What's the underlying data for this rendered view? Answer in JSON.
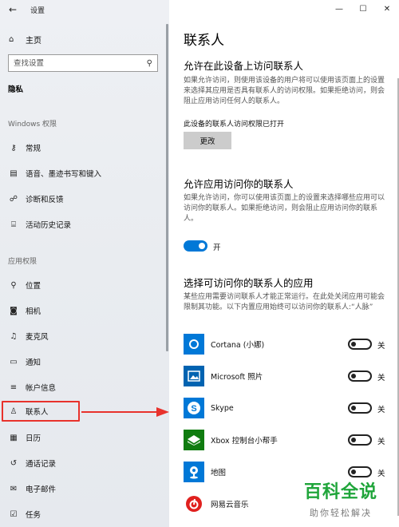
{
  "app": {
    "title": "设置",
    "back_icon": "←"
  },
  "window_controls": {
    "minimize": "—",
    "maximize": "☐",
    "close": "✕"
  },
  "sidebar": {
    "home": {
      "label": "主页",
      "icon": "⌂"
    },
    "search": {
      "placeholder": "查找设置",
      "icon": "⚲"
    },
    "current_section": "隐私",
    "group_windows": "Windows 权限",
    "windows_items": [
      {
        "label": "常规",
        "icon": "lock-icon",
        "glyph": "⚷"
      },
      {
        "label": "语音、墨迹书写和键入",
        "icon": "ink-icon",
        "glyph": "▤"
      },
      {
        "label": "诊断和反馈",
        "icon": "feedback-icon",
        "glyph": "☍"
      },
      {
        "label": "活动历史记录",
        "icon": "history-icon",
        "glyph": "⌸"
      }
    ],
    "group_app": "应用权限",
    "app_items": [
      {
        "label": "位置",
        "icon": "location-icon",
        "glyph": "⚲"
      },
      {
        "label": "相机",
        "icon": "camera-icon",
        "glyph": "◙"
      },
      {
        "label": "麦克风",
        "icon": "microphone-icon",
        "glyph": "♫"
      },
      {
        "label": "通知",
        "icon": "notification-icon",
        "glyph": "▭"
      },
      {
        "label": "帐户信息",
        "icon": "account-info-icon",
        "glyph": "≡"
      },
      {
        "label": "联系人",
        "icon": "contacts-icon",
        "glyph": "♙"
      },
      {
        "label": "日历",
        "icon": "calendar-icon",
        "glyph": "▦"
      },
      {
        "label": "通话记录",
        "icon": "call-history-icon",
        "glyph": "↺"
      },
      {
        "label": "电子邮件",
        "icon": "email-icon",
        "glyph": "✉"
      },
      {
        "label": "任务",
        "icon": "tasks-icon",
        "glyph": "☑"
      }
    ]
  },
  "main": {
    "title": "联系人",
    "section1": {
      "heading": "允许在此设备上访问联系人",
      "description": "如果允许访问，则使用该设备的用户将可以使用该页面上的设置来选择其应用是否具有联系人的访问权限。如果拒绝访问，则会阻止应用访问任何人的联系人。",
      "status": "此设备的联系人访问权限已打开",
      "button": "更改"
    },
    "section2": {
      "heading": "允许应用访问你的联系人",
      "description": "如果允许访问，你可以使用该页面上的设置来选择哪些应用可以访问你的联系人。如果拒绝访问，则会阻止应用访问你的联系人。",
      "toggle_state": "开"
    },
    "section3": {
      "heading": "选择可访问你的联系人的应用",
      "description": "某些应用需要访问联系人才能正常运行。在此处关闭应用可能会限制其功能。以下内置应用始终可以访问你的联系人:“人脉”",
      "apps": [
        {
          "name": "Cortana (小娜)",
          "state": "关",
          "icon": "cortana-icon",
          "color": "#0078d7"
        },
        {
          "name": "Microsoft 照片",
          "state": "关",
          "icon": "photos-icon",
          "color": "#0063b1"
        },
        {
          "name": "Skype",
          "state": "关",
          "icon": "skype-icon",
          "color": "#0078d7"
        },
        {
          "name": "Xbox 控制台小帮手",
          "state": "关",
          "icon": "xbox-icon",
          "color": "#107c10"
        },
        {
          "name": "地图",
          "state": "关",
          "icon": "maps-icon",
          "color": "#0078d7"
        },
        {
          "name": "网易云音乐",
          "state": "",
          "icon": "netease-music-icon",
          "color": "#ffffff"
        }
      ]
    }
  },
  "watermark": {
    "title": "百科全说",
    "subtitle": "助你轻松解决"
  },
  "colors": {
    "accent": "#0078d7",
    "highlight": "#e8322c",
    "watermark_green": "#1fa53a"
  }
}
